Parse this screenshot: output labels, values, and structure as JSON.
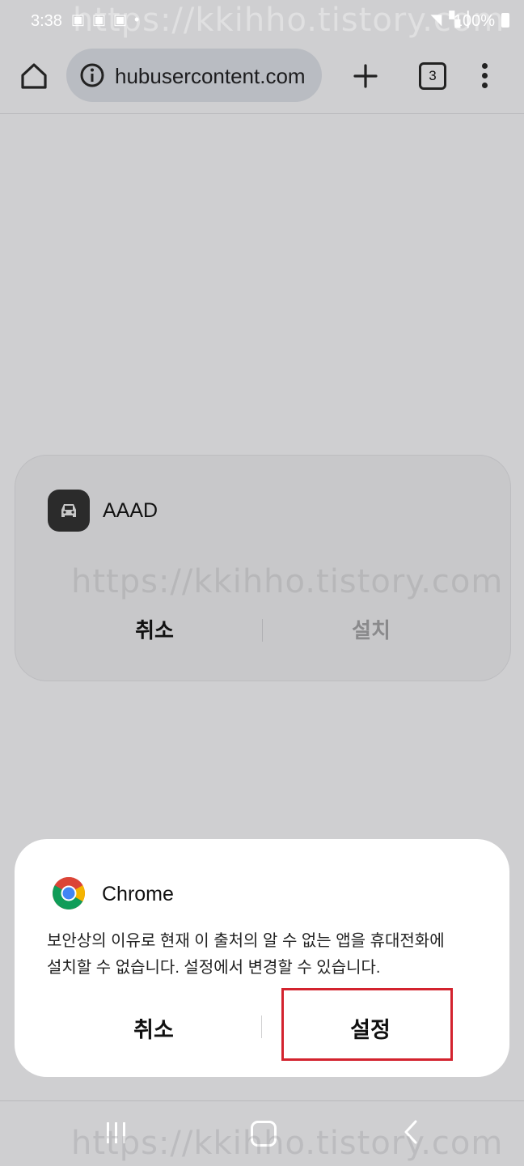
{
  "status_bar": {
    "time": "3:38",
    "left_icons": "▣ ▣ ▣ •",
    "right_icons": "◥ ▚ ▏",
    "battery": "100%"
  },
  "watermark": "https://kkihho.tistory.com",
  "toolbar": {
    "url": "hubusercontent.com",
    "tab_count": "3",
    "icons": [
      "home-icon",
      "info-icon",
      "plus-icon",
      "tabs-icon",
      "more-vert-icon"
    ]
  },
  "install_card": {
    "app_name": "AAAD",
    "cancel_label": "취소",
    "install_label": "설치",
    "install_color": "#8a8a8c"
  },
  "dialog": {
    "title": "Chrome",
    "message_line1": "보안상의 이유로 현재 이 출처의 알 수 없는 앱을 휴대전화에",
    "message_line2": "설치할 수 없습니다. 설정에서 변경할 수 있습니다.",
    "cancel_label": "취소",
    "settings_label": "설정",
    "highlight_color": "#d3232e"
  },
  "nav_bar": {
    "icons": [
      "recent-apps-icon",
      "home-nav-icon",
      "back-icon"
    ]
  }
}
